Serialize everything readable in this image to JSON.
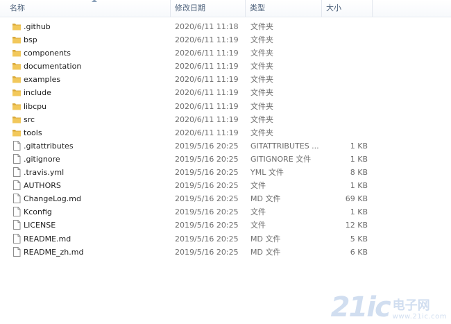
{
  "columns": {
    "name": "名称",
    "date": "修改日期",
    "type": "类型",
    "size": "大小"
  },
  "rows": [
    {
      "name": ".github",
      "date": "2020/6/11 11:18",
      "type": "文件夹",
      "size": "",
      "icon": "folder-icon"
    },
    {
      "name": "bsp",
      "date": "2020/6/11 11:19",
      "type": "文件夹",
      "size": "",
      "icon": "folder-icon"
    },
    {
      "name": "components",
      "date": "2020/6/11 11:19",
      "type": "文件夹",
      "size": "",
      "icon": "folder-icon"
    },
    {
      "name": "documentation",
      "date": "2020/6/11 11:19",
      "type": "文件夹",
      "size": "",
      "icon": "folder-icon"
    },
    {
      "name": "examples",
      "date": "2020/6/11 11:19",
      "type": "文件夹",
      "size": "",
      "icon": "folder-icon"
    },
    {
      "name": "include",
      "date": "2020/6/11 11:19",
      "type": "文件夹",
      "size": "",
      "icon": "folder-icon"
    },
    {
      "name": "libcpu",
      "date": "2020/6/11 11:19",
      "type": "文件夹",
      "size": "",
      "icon": "folder-icon"
    },
    {
      "name": "src",
      "date": "2020/6/11 11:19",
      "type": "文件夹",
      "size": "",
      "icon": "folder-icon"
    },
    {
      "name": "tools",
      "date": "2020/6/11 11:19",
      "type": "文件夹",
      "size": "",
      "icon": "folder-icon"
    },
    {
      "name": ".gitattributes",
      "date": "2019/5/16 20:25",
      "type": "GITATTRIBUTES ...",
      "size": "1 KB",
      "icon": "file-icon"
    },
    {
      "name": ".gitignore",
      "date": "2019/5/16 20:25",
      "type": "GITIGNORE 文件",
      "size": "1 KB",
      "icon": "file-icon"
    },
    {
      "name": ".travis.yml",
      "date": "2019/5/16 20:25",
      "type": "YML 文件",
      "size": "8 KB",
      "icon": "file-icon"
    },
    {
      "name": "AUTHORS",
      "date": "2019/5/16 20:25",
      "type": "文件",
      "size": "1 KB",
      "icon": "file-icon"
    },
    {
      "name": "ChangeLog.md",
      "date": "2019/5/16 20:25",
      "type": "MD 文件",
      "size": "69 KB",
      "icon": "file-icon"
    },
    {
      "name": "Kconfig",
      "date": "2019/5/16 20:25",
      "type": "文件",
      "size": "1 KB",
      "icon": "file-icon"
    },
    {
      "name": "LICENSE",
      "date": "2019/5/16 20:25",
      "type": "文件",
      "size": "12 KB",
      "icon": "file-icon"
    },
    {
      "name": "README.md",
      "date": "2019/5/16 20:25",
      "type": "MD 文件",
      "size": "5 KB",
      "icon": "file-icon"
    },
    {
      "name": "README_zh.md",
      "date": "2019/5/16 20:25",
      "type": "MD 文件",
      "size": "6 KB",
      "icon": "file-icon"
    }
  ],
  "watermark": {
    "number": "21ic",
    "chinese": "电子网",
    "domain": "www.21ic.com"
  },
  "colors": {
    "folder": "#f2c85b",
    "folder_dark": "#d9a93a",
    "header_text": "#4c607a",
    "meta_text": "#6d6d6d"
  }
}
